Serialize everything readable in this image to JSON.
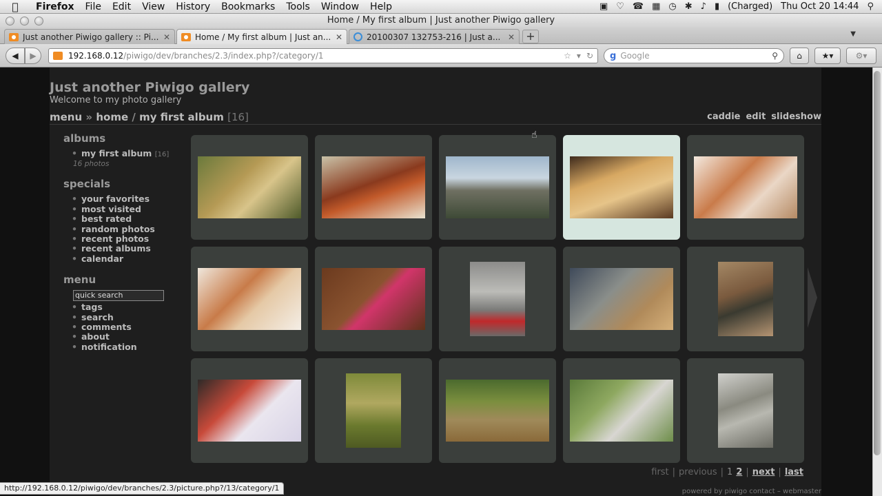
{
  "menubar": {
    "app": "Firefox",
    "items": [
      "File",
      "Edit",
      "View",
      "History",
      "Bookmarks",
      "Tools",
      "Window",
      "Help"
    ],
    "battery": "(Charged)",
    "clock": "Thu Oct 20  14:44"
  },
  "window": {
    "title": "Home / My first album | Just another Piwigo gallery"
  },
  "tabs": [
    {
      "title": "Just another Piwigo gallery :: Pi..."
    },
    {
      "title": "Home / My first album | Just an..."
    },
    {
      "title": "20100307 132753-216 | Just a..."
    }
  ],
  "newtab_label": "+",
  "navbar": {
    "url_host": "192.168.0.12",
    "url_path": "/piwigo/dev/branches/2.3/index.php?/category/1",
    "search_placeholder": "Google"
  },
  "site": {
    "title": "Just another Piwigo gallery",
    "subtitle": "Welcome to my photo gallery"
  },
  "breadcrumb": {
    "menu": "menu",
    "sep1": "»",
    "home": "home",
    "sep2": "/",
    "album": "my first album",
    "count": "[16]"
  },
  "actions": [
    "caddie",
    "edit",
    "slideshow"
  ],
  "sidebar": {
    "albums_title": "albums",
    "album_name": "my first album",
    "album_count": "[16]",
    "album_photos": "16 photos",
    "specials_title": "specials",
    "specials": [
      "your favorites",
      "most visited",
      "best rated",
      "random photos",
      "recent photos",
      "recent albums",
      "calendar"
    ],
    "menu_title": "menu",
    "quick_search": "quick search",
    "menu_items": [
      "tags",
      "search",
      "comments",
      "about",
      "notification"
    ]
  },
  "thumbnails": [
    "potatoes",
    "crab",
    "rocky-shore",
    "biscuits",
    "desserts",
    "salmon-dish",
    "pink-shoes",
    "red-bicycle",
    "toy-warriors",
    "toy-figures",
    "tulips",
    "mushrooms",
    "tree-alley",
    "statue",
    "cherub-statue"
  ],
  "pager": {
    "first": "first",
    "previous": "previous",
    "page1": "1",
    "page2": "2",
    "next": "next",
    "last": "last",
    "sep": "|"
  },
  "footer": "powered by piwigo contact – webmaster",
  "statusbar": "http://192.168.0.12/piwigo/dev/branches/2.3/picture.php?/13/category/1"
}
